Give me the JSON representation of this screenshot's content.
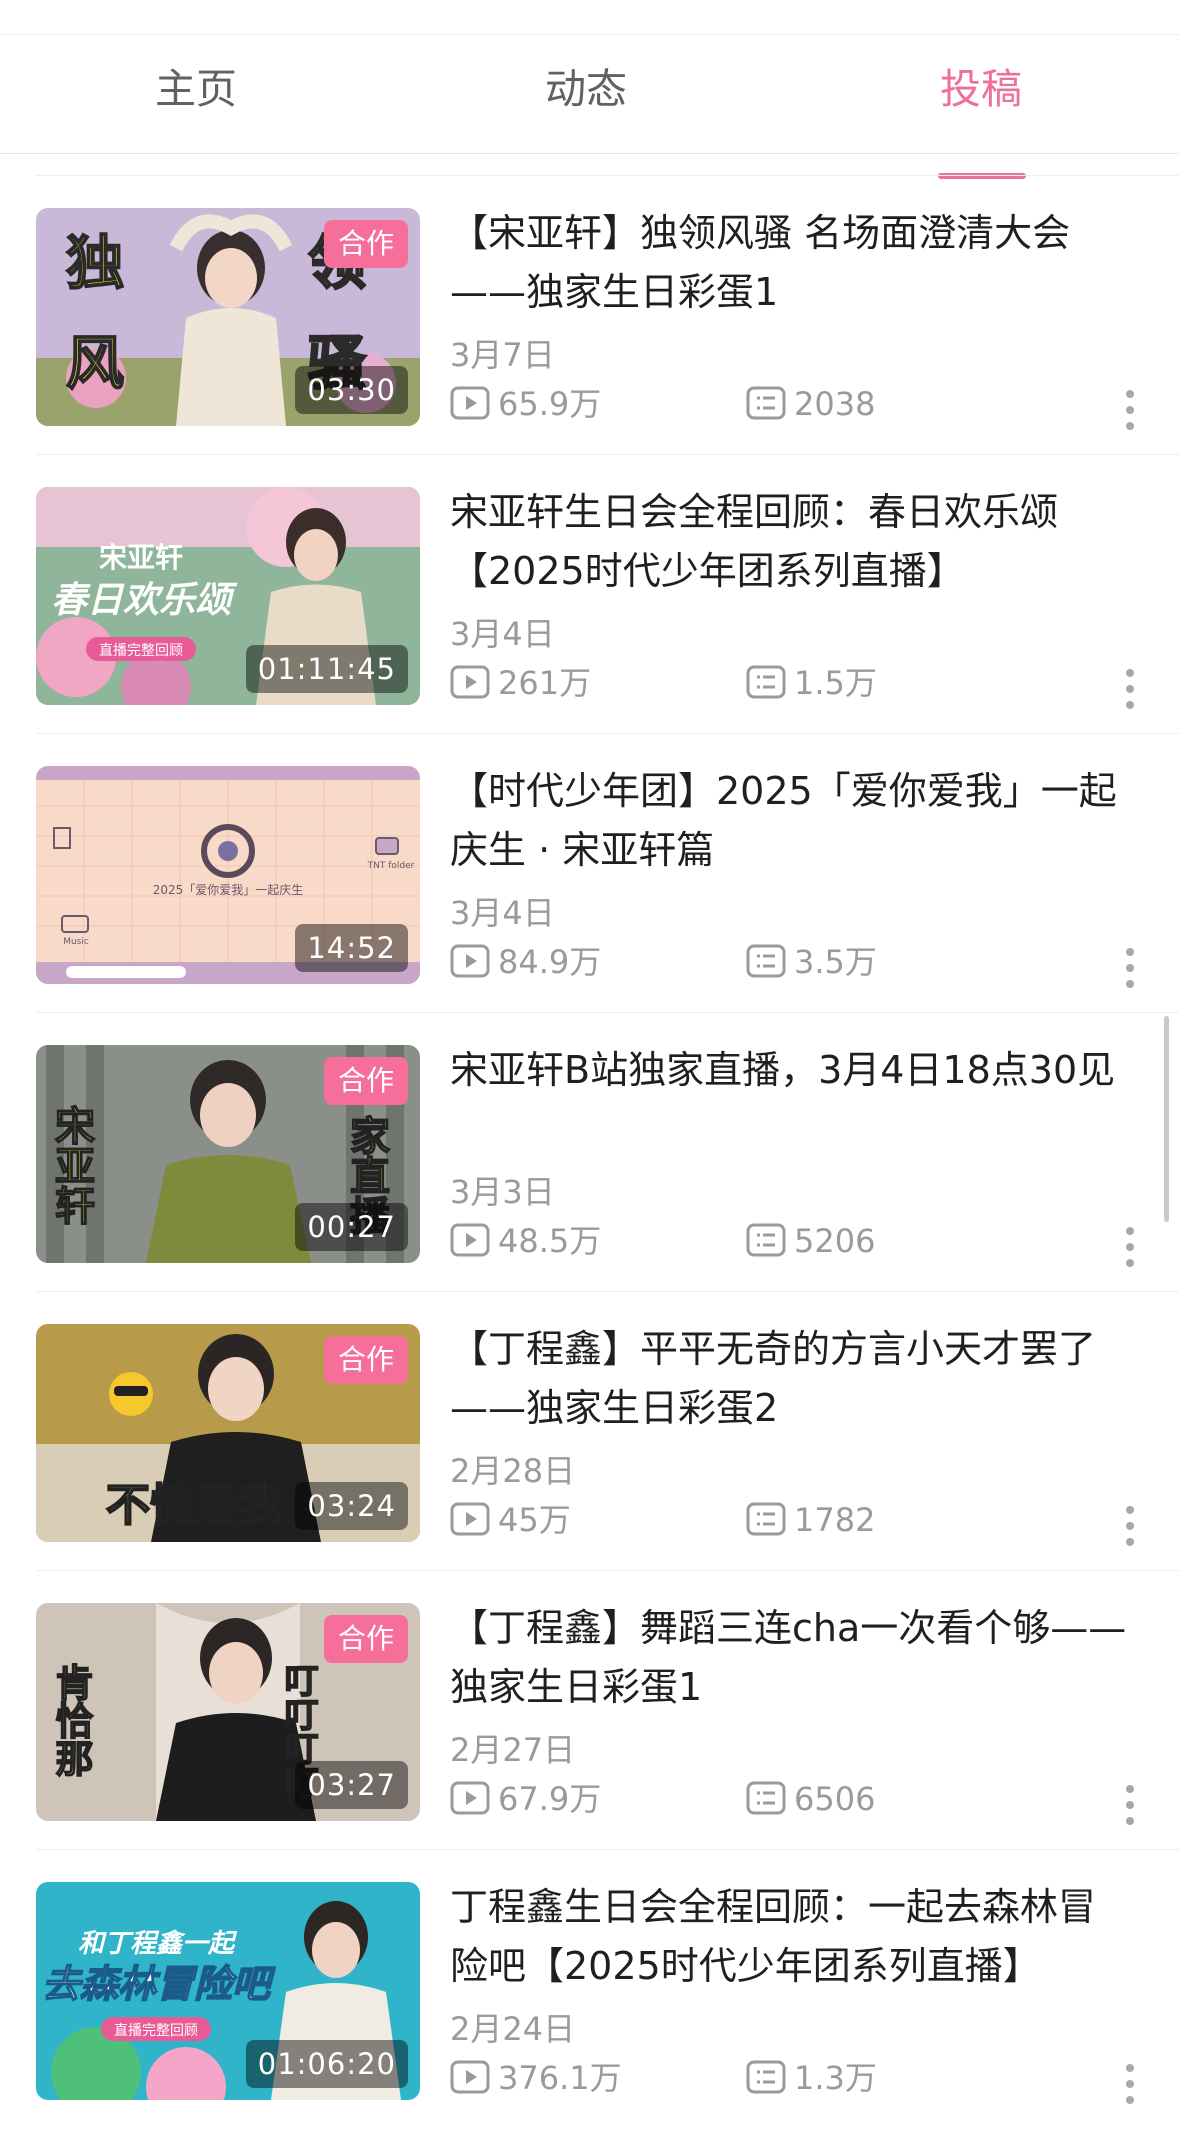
{
  "tabs": [
    {
      "label": "主页",
      "active": false
    },
    {
      "label": "动态",
      "active": false
    },
    {
      "label": "投稿",
      "active": true
    }
  ],
  "accent_color": "#ef6f9c",
  "videos": [
    {
      "title": "【宋亚轩】独领风骚 名场面澄清大会——独家生日彩蛋1",
      "badge": "合作",
      "duration": "03:30",
      "date": "3月7日",
      "views": "65.9万",
      "comments": "2038",
      "thumb_text": [
        "独",
        "风",
        "领",
        "骚"
      ]
    },
    {
      "title": "宋亚轩生日会全程回顾：春日欢乐颂【2025时代少年团系列直播】",
      "badge": "",
      "duration": "01:11:45",
      "date": "3月4日",
      "views": "261万",
      "comments": "1.5万",
      "thumb_text": [
        "宋亚轩",
        "春日欢乐颂",
        "直播完整回顾"
      ]
    },
    {
      "title": "【时代少年团】2025「爱你爱我」一起庆生 · 宋亚轩篇",
      "badge": "",
      "duration": "14:52",
      "date": "3月4日",
      "views": "84.9万",
      "comments": "3.5万",
      "thumb_text": [
        "2025「爱你爱我」一起庆生",
        "TNT folder",
        "Music"
      ]
    },
    {
      "title": "宋亚轩B站独家直播，3月4日18点30见",
      "badge": "合作",
      "duration": "00:27",
      "date": "3月3日",
      "views": "48.5万",
      "comments": "5206",
      "thumb_text": [
        "宋亚轩",
        "家直播"
      ]
    },
    {
      "title": "【丁程鑫】平平无奇的方言小天才罢了——独家生日彩蛋2",
      "badge": "合作",
      "duration": "03:24",
      "date": "2月28日",
      "views": "45万",
      "comments": "1782",
      "thumb_text": [
        "不愧是我"
      ]
    },
    {
      "title": "【丁程鑫】舞蹈三连cha一次看个够——独家生日彩蛋1",
      "badge": "合作",
      "duration": "03:27",
      "date": "2月27日",
      "views": "67.9万",
      "comments": "6506",
      "thumb_text": [
        "肯恰那",
        "叮叮叮叮"
      ]
    },
    {
      "title": "丁程鑫生日会全程回顾：一起去森林冒险吧【2025时代少年团系列直播】",
      "badge": "",
      "duration": "01:06:20",
      "date": "2月24日",
      "views": "376.1万",
      "comments": "1.3万",
      "thumb_text": [
        "和丁程鑫一起",
        "去森林冒险吧",
        "直播完整回顾"
      ]
    }
  ],
  "icons": {
    "views": "play-icon",
    "comments": "comment-icon",
    "more": "more-vertical-icon"
  }
}
